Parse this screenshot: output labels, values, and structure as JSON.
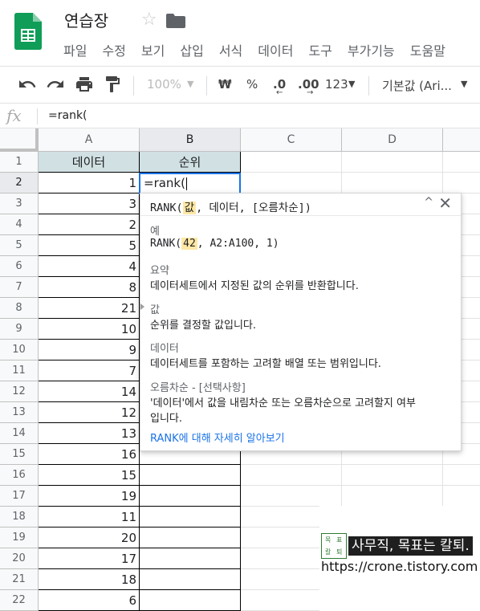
{
  "app": {
    "title": "연습장",
    "menu": [
      "파일",
      "수정",
      "보기",
      "삽입",
      "서식",
      "데이터",
      "도구",
      "부가기능",
      "도움말"
    ]
  },
  "toolbar": {
    "zoom": "100%",
    "currency": "₩",
    "percent": "%",
    "decrease_decimal": ".0",
    "increase_decimal": ".00",
    "more_formats": "123",
    "font": "기본값 (Ari..."
  },
  "formula_bar": {
    "fx": "fx",
    "content": "=rank("
  },
  "grid": {
    "columns": [
      "A",
      "B",
      "C",
      "D"
    ],
    "rows": [
      "1",
      "2",
      "3",
      "4",
      "5",
      "6",
      "7",
      "8",
      "9",
      "10",
      "11",
      "12",
      "13",
      "14",
      "15",
      "16",
      "17",
      "18",
      "19",
      "20",
      "21",
      "22"
    ],
    "header_a": "데이터",
    "header_b": "순위",
    "values_a": [
      "1",
      "3",
      "2",
      "5",
      "4",
      "8",
      "21",
      "10",
      "9",
      "7",
      "14",
      "12",
      "13",
      "16",
      "15",
      "19",
      "11",
      "20",
      "17",
      "18",
      "6"
    ],
    "active_cell_text": "=rank("
  },
  "tooltip": {
    "signature": {
      "fn": "RANK(",
      "arg1": "값",
      "rest": ", 데이터, [오름차순])"
    },
    "example_label": "예",
    "example": {
      "fn": "RANK(",
      "arg1": "42",
      "rest": ", A2:A100, 1)"
    },
    "summary_label": "요약",
    "summary": "데이터세트에서 지정된 값의 순위를 반환합니다.",
    "param1_label": "값",
    "param1_desc": "순위를 결정할 값입니다.",
    "param2_label": "데이터",
    "param2_desc": "데이터세트를 포함하는 고려할 배열 또는 범위입니다.",
    "param3_label": "오름차순 - [선택사항]",
    "param3_desc_line1": "'데이터'에서 값을 내림차순 또는 오름차순으로 고려할지 여부",
    "param3_desc_line2": "입니다.",
    "learn_more": "RANK에 대해 자세히 알아보기",
    "collapse_glyph": "^",
    "close_glyph": "✕"
  },
  "watermark": {
    "logo_chars": [
      "목",
      "표",
      "칼",
      "퇴"
    ],
    "text": "사무직, 목표는 칼퇴.",
    "url": "https://crone.tistory.com"
  },
  "colors": {
    "header_fill": "#d0e0e3",
    "accent_blue": "#1a73e8",
    "sheets_green": "#0f9d58",
    "highlight": "#fde8a6"
  }
}
